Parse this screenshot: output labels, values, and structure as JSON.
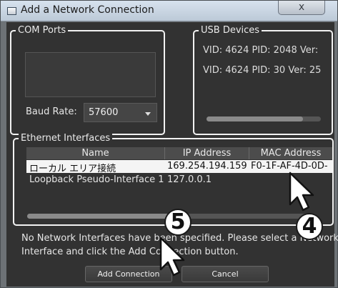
{
  "window": {
    "title": "Add a Network Connection",
    "close_glyph": "x"
  },
  "com_ports": {
    "label": "COM Ports",
    "baud_label": "Baud Rate:",
    "baud_value": "57600"
  },
  "usb_devices": {
    "label": "USB Devices",
    "items": [
      "VID: 4624 PID: 2048 Ver:",
      "VID: 4624 PID: 30 Ver: 25"
    ]
  },
  "ethernet": {
    "label": "Ethernet Interfaces",
    "columns": [
      "Name",
      "IP Address",
      "MAC Address"
    ],
    "rows": [
      {
        "name": "ローカル エリア接続",
        "ip": "169.254.194.159",
        "mac": "F0-1F-AF-4D-0D-"
      },
      {
        "name": "Loopback Pseudo-Interface 1",
        "ip": "127.0.0.1",
        "mac": ""
      }
    ]
  },
  "message": {
    "line1": "No Network Interfaces have been specified. Please select a Network",
    "line2": "Interface and click the Add Connection button."
  },
  "buttons": {
    "add": "Add Connection",
    "cancel": "Cancel"
  },
  "callouts": {
    "step_a": "5",
    "step_b": "4"
  },
  "colors": {
    "window_bg": "#323232",
    "selected_row": "#f4f4f4",
    "group_border": "#f2f2f2"
  }
}
